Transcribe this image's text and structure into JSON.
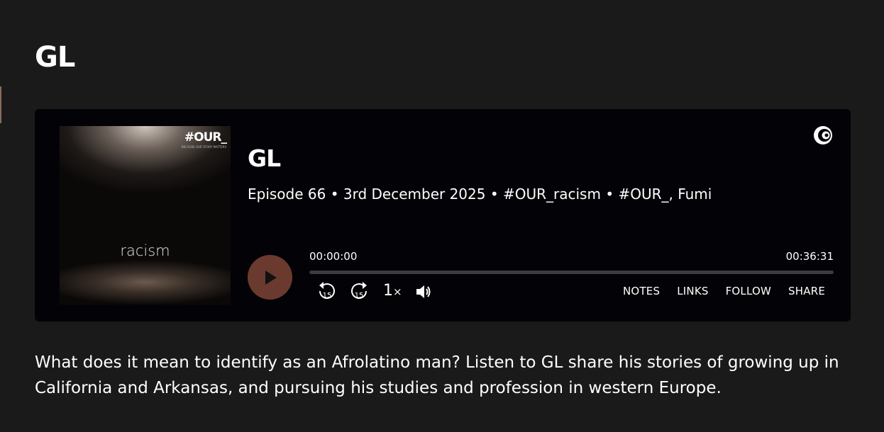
{
  "page": {
    "title": "GL"
  },
  "cover": {
    "brand": "#OUR_",
    "brand_sub": "BECAUSE OUR STORY MATTERS",
    "word": "racism"
  },
  "player": {
    "episode_title": "GL",
    "meta": "Episode 66 • 3rd December 2025 • #OUR_racism • #OUR_, Fumi",
    "time_current": "00:00:00",
    "time_total": "00:36:31",
    "progress": 0,
    "rewind_label": "15",
    "forward_label": "15",
    "speed_value": "1",
    "speed_suffix": "×",
    "links": [
      "NOTES",
      "LINKS",
      "FOLLOW",
      "SHARE"
    ],
    "accent": "#6b3a2f"
  },
  "description": "What does it mean to identify as an Afrolatino man? Listen to GL share his stories of growing up in California and Arkansas, and pursuing his studies and profession in western Europe."
}
